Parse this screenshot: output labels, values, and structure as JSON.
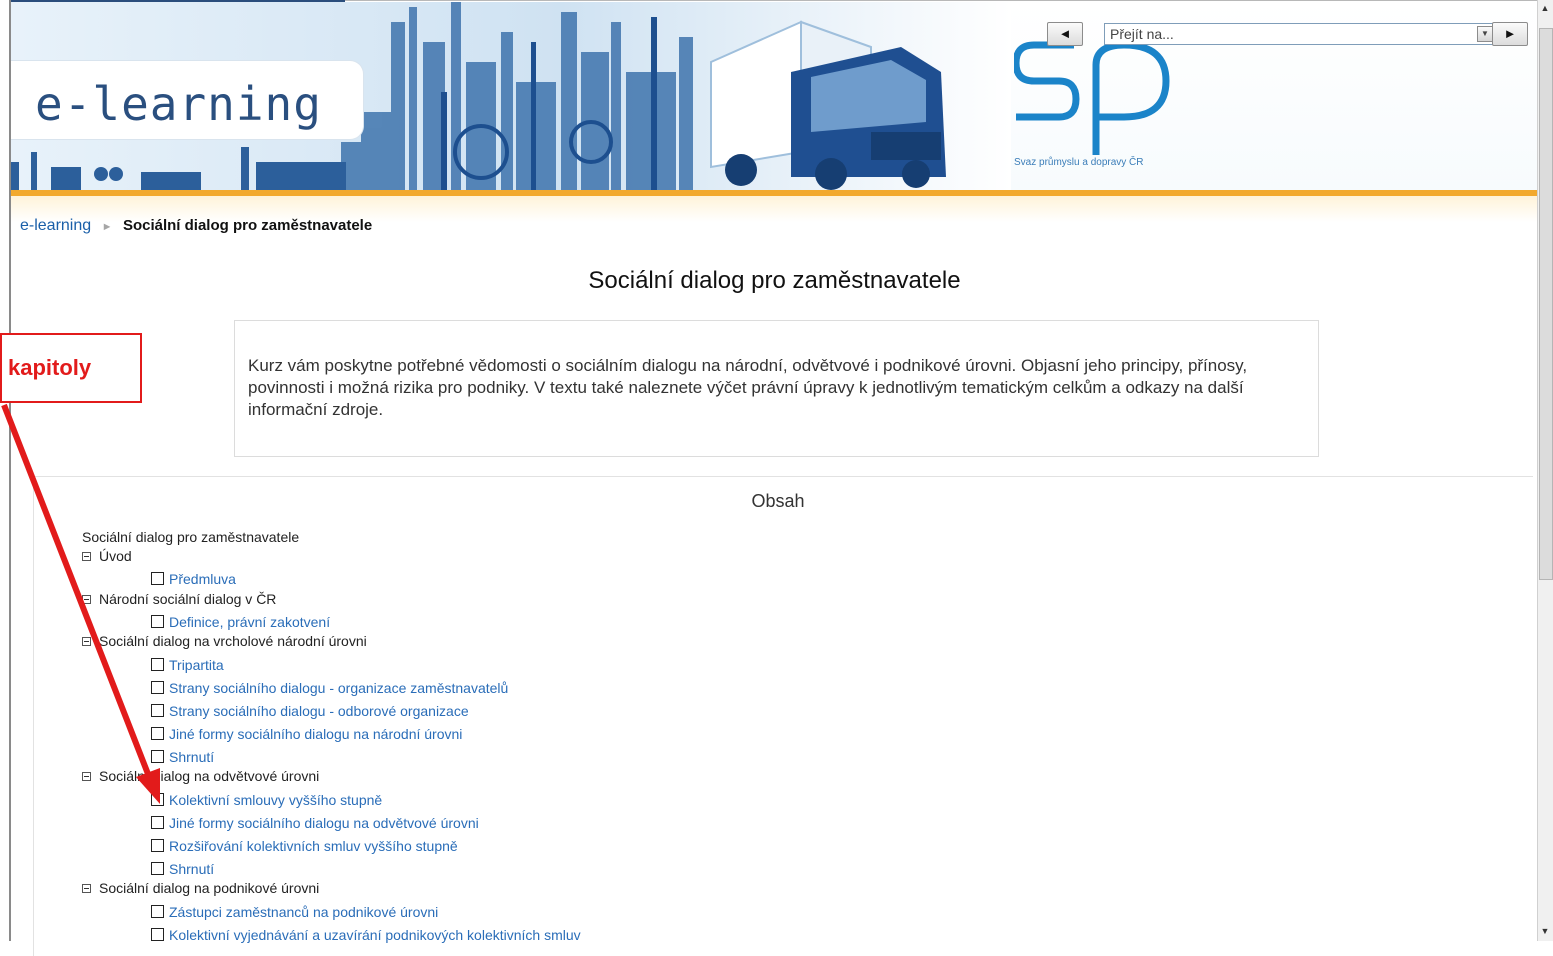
{
  "header": {
    "logo_text": "e-learning",
    "org_caption": "Svaz průmyslu a dopravy ČR",
    "org_logo_alt": "sp"
  },
  "nav": {
    "prev_label": "◄",
    "next_label": "►",
    "jump_placeholder": "Přejít na..."
  },
  "breadcrumb": {
    "home": "e-learning",
    "separator": "►",
    "current": "Sociální dialog pro zaměstnavatele"
  },
  "page": {
    "title": "Sociální dialog pro zaměstnavatele",
    "summary": "Kurz vám poskytne potřebné vědomosti o sociálním dialogu na národní, odvětvové i podnikové úrovni. Objasní jeho principy, přínosy, povinnosti i možná rizika pro podniky. V textu také naleznete výčet právní úpravy k jednotlivým tematickým celkům a odkazy na další informační zdroje."
  },
  "toc": {
    "title": "Obsah",
    "root": "Sociální dialog pro zaměstnavatele",
    "sections": [
      {
        "label": "Úvod",
        "items": [
          "Předmluva"
        ]
      },
      {
        "label": "Národní sociální dialog v ČR",
        "items": [
          "Definice, právní zakotvení"
        ]
      },
      {
        "label": "Sociální dialog na vrcholové národní úrovni",
        "items": [
          "Tripartita",
          "Strany sociálního dialogu - organizace zaměstnavatelů",
          "Strany sociálního dialogu - odborové organizace",
          "Jiné formy sociálního dialogu na národní úrovni",
          "Shrnutí"
        ]
      },
      {
        "label": "Sociální dialog na odvětvové úrovni",
        "items": [
          "Kolektivní smlouvy vyššího stupně",
          "Jiné formy sociálního dialogu na odvětvové úrovni",
          "Rozšiřování kolektivních smluv vyššího stupně",
          "Shrnutí"
        ]
      },
      {
        "label": "Sociální dialog na podnikové úrovni",
        "items": [
          "Zástupci zaměstnanců na podnikové úrovni",
          "Kolektivní vyjednávání a uzavírání podnikových kolektivních smluv"
        ]
      }
    ]
  },
  "annotation": {
    "label": "kapitoly",
    "color": "#e21b1b"
  },
  "colors": {
    "accent_orange": "#f2a92e",
    "link_blue": "#2a6db8",
    "brand_blue": "#2a4f7f"
  }
}
